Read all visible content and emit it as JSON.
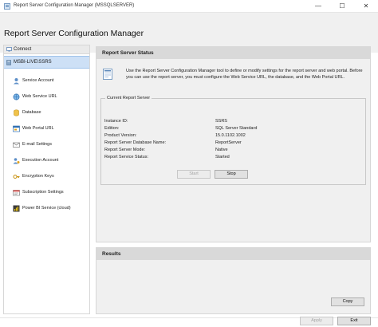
{
  "window": {
    "title": "Report Server Configuration Manager (MSSQLSERVER)",
    "minimize_glyph": "—",
    "maximize_glyph": "☐",
    "close_glyph": "✕"
  },
  "header": {
    "title": "Report Server Configuration Manager"
  },
  "sidebar": {
    "connect_label": "Connect",
    "server_label": "MSBI-LIVE\\SSRS",
    "items": [
      {
        "label": "Service Account",
        "icon": "service-account-icon"
      },
      {
        "label": "Web Service URL",
        "icon": "web-service-url-icon"
      },
      {
        "label": "Database",
        "icon": "database-icon"
      },
      {
        "label": "Web Portal URL",
        "icon": "web-portal-url-icon"
      },
      {
        "label": "E-mail Settings",
        "icon": "email-icon"
      },
      {
        "label": "Execution Account",
        "icon": "execution-account-icon"
      },
      {
        "label": "Encryption Keys",
        "icon": "encryption-keys-icon"
      },
      {
        "label": "Subscription Settings",
        "icon": "subscription-settings-icon"
      },
      {
        "label": "Power BI Service (cloud)",
        "icon": "power-bi-icon"
      }
    ]
  },
  "status_panel": {
    "title": "Report Server Status",
    "intro_text": "Use the Report Server Configuration Manager tool to define or modify settings for the report server and web portal. Before you can use the report server, you must configure the Web Service URL, the database, and the Web Portal URL.",
    "group_title": "Current Report Server",
    "fields": [
      {
        "label": "Instance ID:",
        "value": "SSRS"
      },
      {
        "label": "Edition:",
        "value": "SQL Server Standard"
      },
      {
        "label": "Product Version:",
        "value": "15.0.1102.1002"
      },
      {
        "label": "Report Server Database Name:",
        "value": "ReportServer"
      },
      {
        "label": "Report Server Mode:",
        "value": "Native"
      },
      {
        "label": "Report Service Status:",
        "value": "Started"
      }
    ],
    "start_label": "Start",
    "stop_label": "Stop"
  },
  "results_panel": {
    "title": "Results",
    "copy_label": "Copy"
  },
  "footer": {
    "apply_label": "Apply",
    "exit_label": "Exit"
  }
}
